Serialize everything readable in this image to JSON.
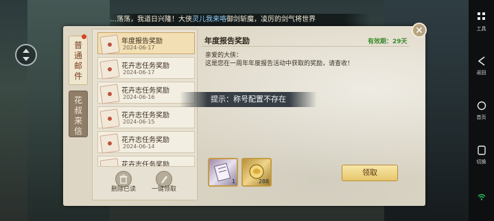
{
  "marquee": {
    "text_a": "…荡荡，我道日兴隆！大侠",
    "text_highlight": "灵儿我来咯",
    "text_b": "御剑斩魔，凌厉的剑气将世界"
  },
  "tabs": {
    "mail": "普通邮件",
    "letter": "花叔来信"
  },
  "mail_list": [
    {
      "title": "年度报告奖励",
      "date": "2024-06-17",
      "selected": true
    },
    {
      "title": "花卉志任务奖励",
      "date": "2024-06-17",
      "selected": false
    },
    {
      "title": "花卉志任务奖励",
      "date": "2024-06-16",
      "selected": false
    },
    {
      "title": "花卉志任务奖励",
      "date": "2024-06-15",
      "selected": false
    },
    {
      "title": "花卉志任务奖励",
      "date": "2024-06-14",
      "selected": false
    },
    {
      "title": "花卉志任务奖励",
      "date": "",
      "selected": false
    }
  ],
  "list_actions": {
    "delete_read": "删除已读",
    "claim_all": "一键领取"
  },
  "mail": {
    "title": "年度报告奖励",
    "validity": "有效期：29天",
    "greeting": "亲爱的大侠：",
    "body": "这是您在一周年年度报告活动中获取的奖励，请查收！"
  },
  "toast": "提示：称号配置不存在",
  "rewards": [
    {
      "icon": "scroll-item-icon",
      "count": "1"
    },
    {
      "icon": "gold-dragon-item-icon",
      "count": "288"
    }
  ],
  "claim_button": "领取",
  "nav": {
    "tools": "工具",
    "back": "返回",
    "home": "首页",
    "switch": "切换"
  },
  "colors": {
    "accent_gold": "#e7c66b",
    "validity_green": "#3b8a2d",
    "unread_dot": "#d4432a"
  }
}
